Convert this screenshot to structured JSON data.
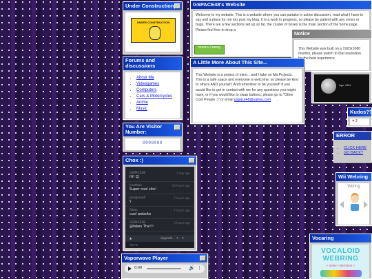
{
  "under_construction": {
    "title": "Under Construction",
    "sign_text": "UNDER CONSTRUCTION"
  },
  "forums": {
    "title": "Forums and discussions",
    "items": [
      "About Me",
      "Videogames",
      "Computers",
      "Cars & Motorcycles",
      "Anime",
      "Music"
    ]
  },
  "visitor": {
    "title": "You Are Visitor Number:",
    "count": "0000000"
  },
  "welcome": {
    "title": "GSPACE48's Website",
    "text": "Welcome to my website. This is a website where you can partake in active discussion, read what I have to say and a place for me too post my blog. It is a work in progress, so please be patient with any errors or bugs. There are a few sections set up so far, the cluster of boxes is the main section of the home page. Please feel free to drop a",
    "badge": "Nook's Cranny"
  },
  "notice": {
    "title": "Notice",
    "text": "This Website was built on a 1920x1080 monitor, please switch to that resolution for the best experience."
  },
  "about": {
    "title": "A Little More About This Site...",
    "text": "This Website is a project of mine... and I take on Ma Projects. This is a safe space and everyone is welcome, so please be kind to others AND yourself. And remember to be yourself! If you would like to get in contact with me for any questions you might have, or if you would like to swap buttons, please go to \"Other Cool People :)\" or email",
    "email": "gspace48@yahoo.com"
  },
  "photo_caption": "Age: 66%",
  "kudos": {
    "title": "Kudos??",
    "count": "2"
  },
  "error": {
    "title": "ERROR",
    "link1": "CLICK HERE",
    "link2": "GO BACK?"
  },
  "chat": {
    "title": "Chox :)",
    "messages": [
      {
        "user": "GSPACE48",
        "time": "1 day ago",
        "text": "Hi! 😊"
      },
      {
        "user": "Jinathan",
        "time": "18 hours ago",
        "text": "Super cool site!"
      },
      {
        "user": "penguino0",
        "time": "7 hours ago",
        "text": "ʕ"
      },
      {
        "user": "fakes",
        "time": "7 hours ago",
        "text": "cool website"
      },
      {
        "user": "GSPACE48",
        "time": "3 hours ago",
        "text": "@fakes Thx!!!"
      }
    ],
    "upgrade": "Upgrade",
    "name_placeholder": "Name"
  },
  "wii": {
    "title": "Wii Webring",
    "header": "Wiiring"
  },
  "player": {
    "title": "Vaporwave Player",
    "time": "0:00"
  },
  "vocaring": {
    "title": "Vocaring",
    "banner": "VOCALOID WEBRING",
    "sub": "« Index • Members »"
  }
}
